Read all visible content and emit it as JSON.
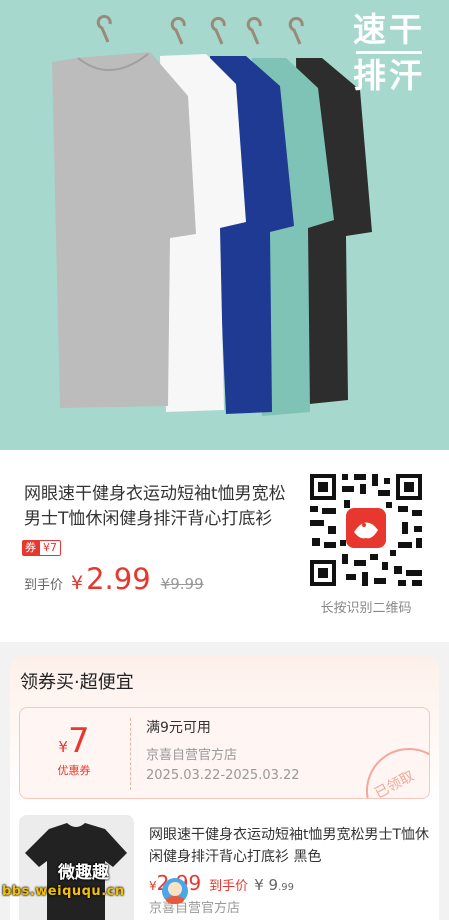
{
  "hero": {
    "badge_line1": "速干",
    "badge_line2": "排汗"
  },
  "product": {
    "title": "网眼速干健身衣运动短袖t恤男宽松男士T恤休闲健身排汗背心打底衫",
    "coupon_tag_key": "券",
    "coupon_tag_value": "¥7",
    "price_label": "到手价",
    "price_currency": "¥",
    "price_value": "2.99",
    "price_original": "¥9.99",
    "qr_caption": "长按识别二维码"
  },
  "coupon_section": {
    "title": "领券买·超便宜",
    "coupon": {
      "currency": "¥",
      "amount": "7",
      "label": "优惠券",
      "condition": "满9元可用",
      "shop": "京喜自营官方店",
      "validity": "2025.03.22-2025.03.22",
      "stamp": "已领取"
    },
    "item": {
      "title": "网眼速干健身衣运动短袖t恤男宽松男士T恤休闲健身排汗背心打底衫 黑色",
      "price_currency": "¥",
      "price_value": "2.99",
      "price_label": "到手价",
      "price_original_currency": "¥",
      "price_original_int": "9",
      "price_original_dec": ".99",
      "shop": "京喜自营官方店"
    }
  },
  "watermark": {
    "name": "微趣趣",
    "url": "bbs.weiququ.cn"
  },
  "colors": {
    "accent": "#e8372e",
    "hero_bg": "#a6d8cd"
  }
}
